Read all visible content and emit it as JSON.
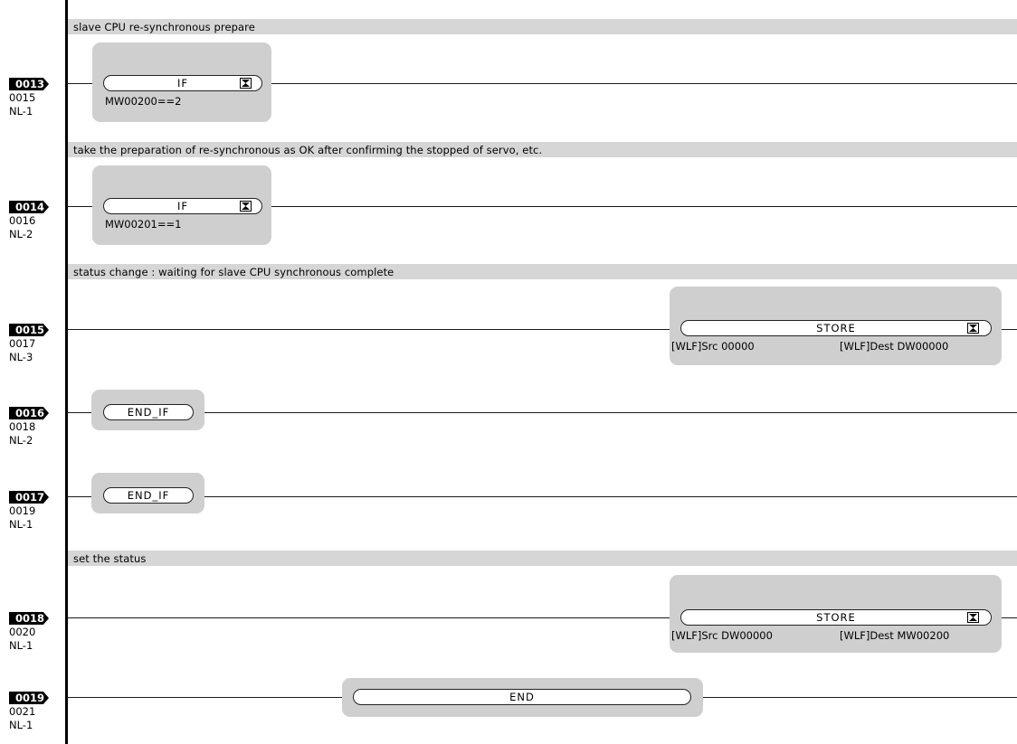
{
  "comments": {
    "c1": "slave CPU re-synchronous prepare",
    "c2": "take the preparation of re-synchronous as OK after confirming the stopped of servo, etc.",
    "c3": "status change : waiting for slave CPU synchronous complete",
    "c4": "set the status"
  },
  "rungs": [
    {
      "num": "0013",
      "step": "0015",
      "nest": "NL-1"
    },
    {
      "num": "0014",
      "step": "0016",
      "nest": "NL-2"
    },
    {
      "num": "0015",
      "step": "0017",
      "nest": "NL-3"
    },
    {
      "num": "0016",
      "step": "0018",
      "nest": "NL-2"
    },
    {
      "num": "0017",
      "step": "0019",
      "nest": "NL-1"
    },
    {
      "num": "0018",
      "step": "0020",
      "nest": "NL-1"
    },
    {
      "num": "0019",
      "step": "0021",
      "nest": "NL-1"
    }
  ],
  "instructions": {
    "if1": {
      "label": "IF",
      "condition": "MW00200==2"
    },
    "if2": {
      "label": "IF",
      "condition": "MW00201==1"
    },
    "store1": {
      "label": "STORE",
      "src": "[WLF]Src  00000",
      "dest": "[WLF]Dest  DW00000"
    },
    "endif1": {
      "label": "END_IF"
    },
    "endif2": {
      "label": "END_IF"
    },
    "store2": {
      "label": "STORE",
      "src": "[WLF]Src  DW00000",
      "dest": "[WLF]Dest  MW00200"
    },
    "end": {
      "label": "END"
    }
  }
}
